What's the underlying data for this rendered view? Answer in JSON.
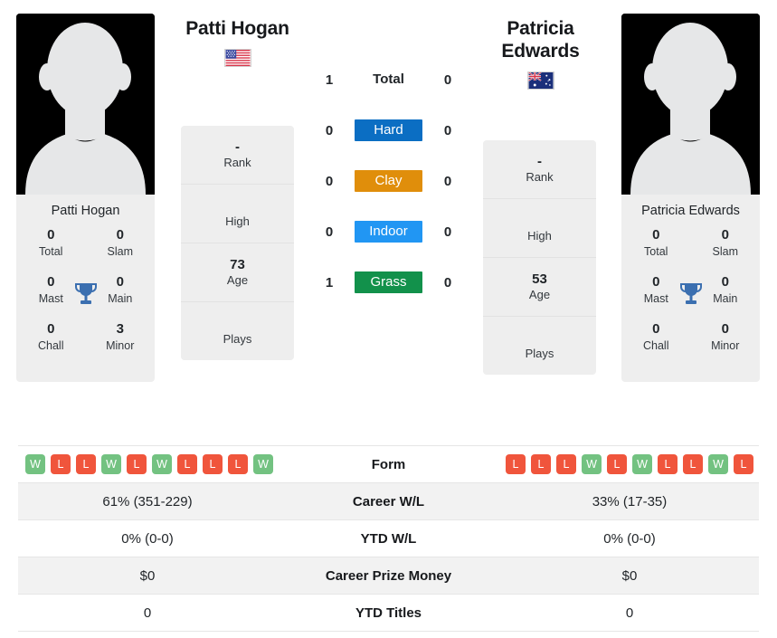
{
  "players": {
    "left": {
      "name": "Patti Hogan",
      "photo_caption": "Patti Hogan",
      "country_flag": "us-flag-icon",
      "avatar": "player-silhouette-icon",
      "titles": {
        "total_label": "Total",
        "total_value": "0",
        "slam_label": "Slam",
        "slam_value": "0",
        "mast_label": "Mast",
        "mast_value": "0",
        "main_label": "Main",
        "main_value": "0",
        "chall_label": "Chall",
        "chall_value": "0",
        "minor_label": "Minor",
        "minor_value": "3"
      },
      "info": [
        {
          "value": "-",
          "label": "Rank"
        },
        {
          "value": "",
          "label": "High"
        },
        {
          "value": "73",
          "label": "Age"
        },
        {
          "value": "",
          "label": "Plays"
        }
      ],
      "form": [
        "W",
        "L",
        "L",
        "W",
        "L",
        "W",
        "L",
        "L",
        "L",
        "W"
      ]
    },
    "right": {
      "name": "Patricia Edwards",
      "photo_caption": "Patricia Edwards",
      "country_flag": "au-flag-icon",
      "avatar": "player-silhouette-icon",
      "titles": {
        "total_label": "Total",
        "total_value": "0",
        "slam_label": "Slam",
        "slam_value": "0",
        "mast_label": "Mast",
        "mast_value": "0",
        "main_label": "Main",
        "main_value": "0",
        "chall_label": "Chall",
        "chall_value": "0",
        "minor_label": "Minor",
        "minor_value": "0"
      },
      "info": [
        {
          "value": "-",
          "label": "Rank"
        },
        {
          "value": "",
          "label": "High"
        },
        {
          "value": "53",
          "label": "Age"
        },
        {
          "value": "",
          "label": "Plays"
        }
      ],
      "form": [
        "L",
        "L",
        "L",
        "W",
        "L",
        "W",
        "L",
        "L",
        "W",
        "L"
      ]
    }
  },
  "surfaces": [
    {
      "label": "Total",
      "left": "1",
      "right": "0",
      "color": "none",
      "badge": false
    },
    {
      "label": "Hard",
      "left": "0",
      "right": "0",
      "color": "#0b6ec3",
      "badge": true
    },
    {
      "label": "Clay",
      "left": "0",
      "right": "0",
      "color": "#e08e0b",
      "badge": true
    },
    {
      "label": "Indoor",
      "left": "0",
      "right": "0",
      "color": "#2196f3",
      "badge": true
    },
    {
      "label": "Grass",
      "left": "1",
      "right": "0",
      "color": "#12914b",
      "badge": true
    }
  ],
  "stats_rows": [
    {
      "label": "Form",
      "left": "",
      "right": "",
      "type": "form",
      "shaded": false
    },
    {
      "label": "Career W/L",
      "left": "61% (351-229)",
      "right": "33% (17-35)",
      "type": "text",
      "shaded": true
    },
    {
      "label": "YTD W/L",
      "left": "0% (0-0)",
      "right": "0% (0-0)",
      "type": "text",
      "shaded": false
    },
    {
      "label": "Career Prize Money",
      "left": "$0",
      "right": "$0",
      "type": "text",
      "shaded": true
    },
    {
      "label": "YTD Titles",
      "left": "0",
      "right": "0",
      "type": "text",
      "shaded": false
    }
  ],
  "colors": {
    "hard": "#0b6ec3",
    "clay": "#e08e0b",
    "indoor": "#2196f3",
    "grass": "#12914b",
    "win_badge": "#73c281",
    "loss_badge": "#f0553c",
    "trophy": "#3b6fb0",
    "card_bg": "#eeeeee",
    "row_shade": "#f2f2f2"
  }
}
